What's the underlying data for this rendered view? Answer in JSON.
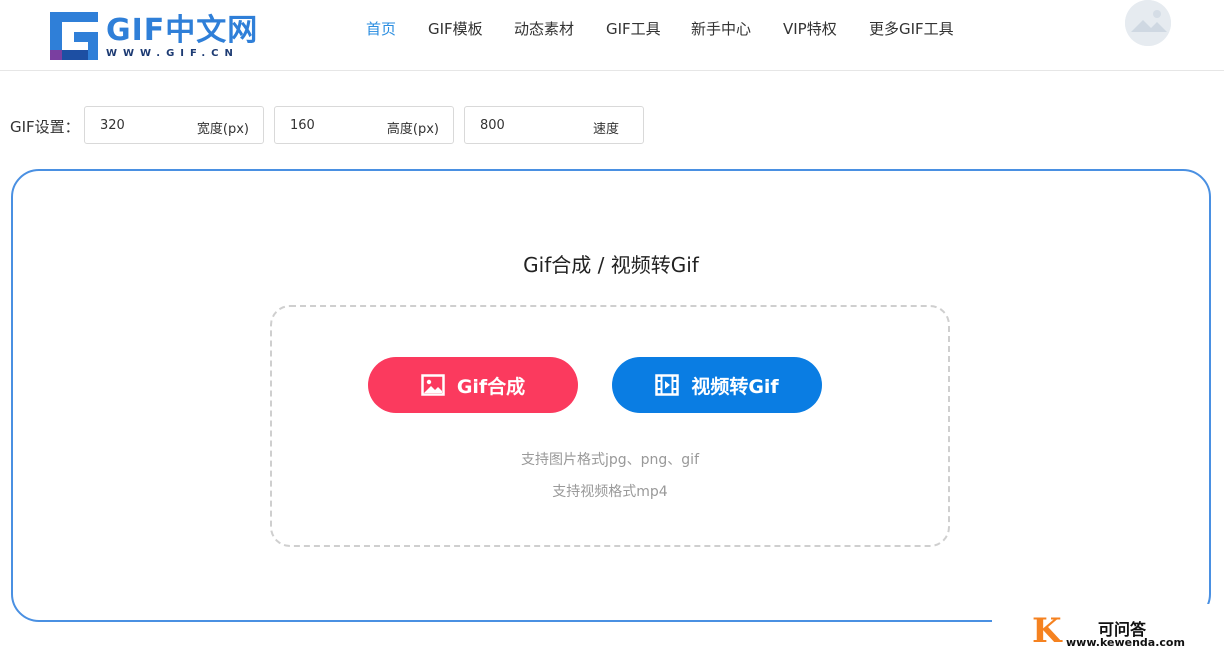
{
  "header": {
    "logo_text": "GIF中文网",
    "logo_url": "WWW.GIF.CN",
    "nav": [
      {
        "label": "首页"
      },
      {
        "label": "GIF模板"
      },
      {
        "label": "动态素材"
      },
      {
        "label": "GIF工具"
      },
      {
        "label": "新手中心"
      },
      {
        "label": "VIP特权"
      },
      {
        "label": "更多GIF工具"
      }
    ],
    "active_nav": "首页"
  },
  "settings": {
    "label": "GIF设置：",
    "width": {
      "value": "320",
      "unit": "宽度(px)"
    },
    "height": {
      "value": "160",
      "unit": "高度(px)"
    },
    "speed": {
      "value": "800",
      "unit": "速度"
    }
  },
  "main": {
    "title": "Gif合成 / 视频转Gif",
    "gif_button": "Gif合成",
    "video_button": "视频转Gif",
    "hint_images": "支持图片格式jpg、png、gif",
    "hint_video": "支持视频格式mp4"
  },
  "watermark": {
    "letter": "K",
    "name": "可问答",
    "url": "www.kewenda.com"
  },
  "colors": {
    "accent": "#2a8de0",
    "card_border": "#4a90e2",
    "gif_button": "#fb3a5e",
    "video_button": "#0a7de3"
  },
  "icons": {
    "gif_button_icon": "image-icon",
    "video_button_icon": "film-icon"
  }
}
